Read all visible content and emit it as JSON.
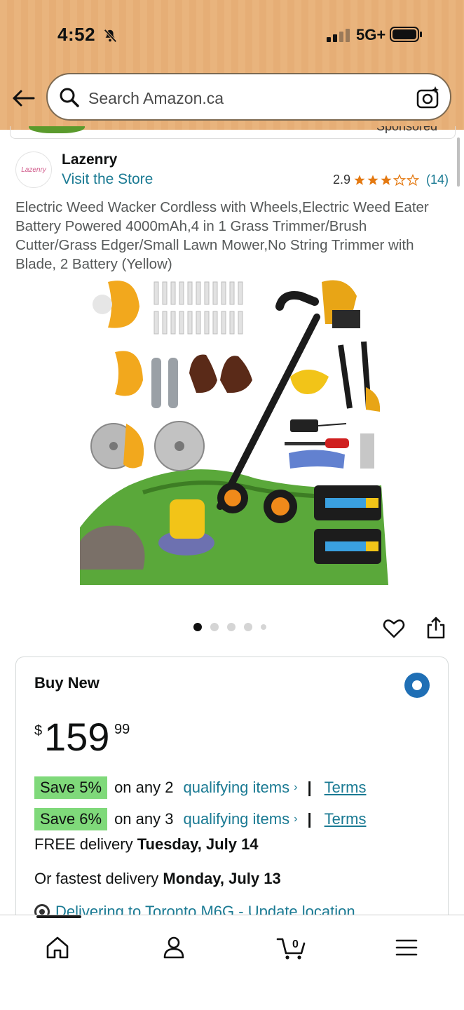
{
  "status_bar": {
    "time": "4:52",
    "network": "5G+"
  },
  "search": {
    "placeholder": "Search Amazon.ca"
  },
  "sponsored": {
    "label": "Sponsored"
  },
  "store": {
    "brand": "Lazenry",
    "logo_text": "Lazenry",
    "visit_label": "Visit the Store",
    "rating_value": "2.9",
    "rating_stars": 2.9,
    "rating_count": "(14)"
  },
  "product": {
    "title": "Electric Weed Wacker Cordless with Wheels,Electric Weed Eater Battery Powered 4000mAh,4 in 1 Grass Trimmer/Brush Cutter/Grass Edger/Small Lawn Mower,No String Trimmer with Blade, 2 Battery (Yellow)",
    "image_count": 5,
    "active_image": 1
  },
  "buy_box": {
    "title": "Buy New",
    "price_currency": "$",
    "price_whole": "159",
    "price_fraction": "99",
    "promos": [
      {
        "badge": "Save 5%",
        "text": "on any 2",
        "link": "qualifying items",
        "terms": "Terms"
      },
      {
        "badge": "Save 6%",
        "text": "on any 3",
        "link": "qualifying items",
        "terms": "Terms"
      }
    ],
    "delivery": {
      "prefix": "FREE delivery ",
      "date": "Tuesday, July 14"
    },
    "fastest": {
      "prefix": "Or fastest delivery ",
      "date": "Monday, July 13"
    },
    "location": "Delivering to Toronto M6G - Update location"
  },
  "bottom_nav": {
    "items": [
      "home-icon",
      "account-icon",
      "cart-icon",
      "menu-icon"
    ],
    "cart_count": "0"
  },
  "colors": {
    "header": "#e9b47d",
    "link": "#1a7a93",
    "star": "#e47911",
    "promo_badge": "#7fd97a",
    "radio": "#1f6fb5"
  }
}
